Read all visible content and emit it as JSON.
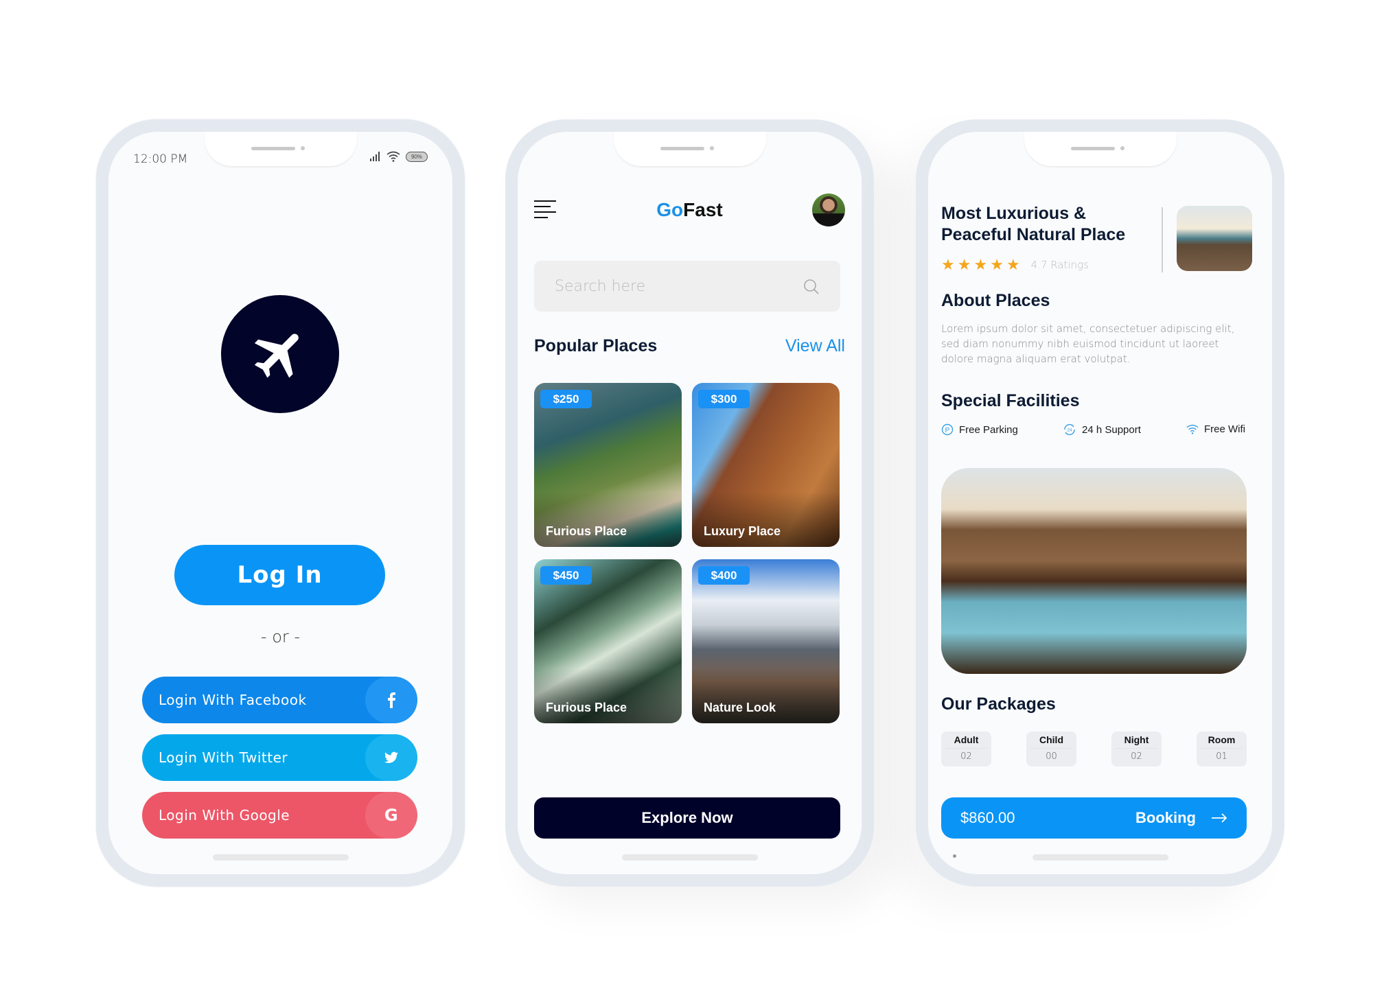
{
  "login_screen": {
    "status": {
      "time": "12:00 PM",
      "battery": "90%",
      "signal_icon": "signal-icon",
      "wifi_icon": "wifi-icon"
    },
    "logo_icon": "airplane-icon",
    "login_label": "Log In",
    "or_label": "- or -",
    "social": [
      {
        "label": "Login With Facebook",
        "icon": "f",
        "icon_name": "facebook-icon",
        "color": "#0d87ea"
      },
      {
        "label": "Login With Twitter",
        "icon": "twitter",
        "icon_name": "twitter-icon",
        "color": "#04a8ea"
      },
      {
        "label": "Login With Google",
        "icon": "G",
        "icon_name": "google-icon",
        "color": "#ec5667"
      }
    ]
  },
  "home_screen": {
    "brand": {
      "accent": "Go",
      "rest": "Fast",
      "accent_color": "#1a91e8"
    },
    "search": {
      "placeholder": "Search here",
      "value": ""
    },
    "section_title": "Popular Places",
    "view_all": "View All",
    "places": [
      {
        "price": "$250",
        "name": "Furious Place"
      },
      {
        "price": "$300",
        "name": "Luxury Place"
      },
      {
        "price": "$450",
        "name": "Furious Place"
      },
      {
        "price": "$400",
        "name": "Nature Look"
      }
    ],
    "explore_label": "Explore Now"
  },
  "detail_screen": {
    "title": "Most Luxurious & Peaceful Natural Place",
    "stars": 5,
    "rating_text": "4.7 Ratings",
    "about_title": "About Places",
    "about_text": "Lorem ipsum dolor sit amet, consectetuer adipiscing elit, sed diam nonummy nibh euismod tincidunt ut laoreet dolore magna aliquam erat volutpat.",
    "facilities_title": "Special Facilities",
    "facilities": [
      {
        "label": "Free Parking",
        "icon": "parking-icon"
      },
      {
        "label": "24 h Support",
        "icon": "support-24h-icon"
      },
      {
        "label": "Free Wifi",
        "icon": "wifi-icon"
      }
    ],
    "packages_title": "Our Packages",
    "packages": [
      {
        "label": "Adult",
        "value": "02"
      },
      {
        "label": "Child",
        "value": "00"
      },
      {
        "label": "Night",
        "value": "02"
      },
      {
        "label": "Room",
        "value": "01"
      }
    ],
    "price": "$860.00",
    "booking_label": "Booking"
  },
  "colors": {
    "primary_blue": "#0a95f6",
    "navy": "#01022a",
    "heading": "#0d1b33",
    "star": "#f4a61c"
  }
}
